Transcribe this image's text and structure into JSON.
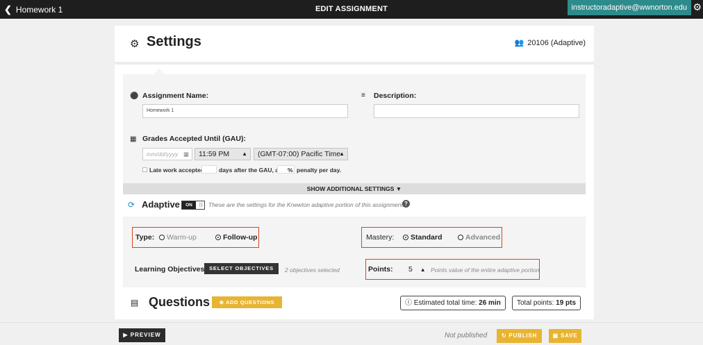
{
  "topbar": {
    "back_label": "Homework 1",
    "title": "EDIT ASSIGNMENT",
    "user_email": "instructoradaptive@wwnorton.edu"
  },
  "settings": {
    "title": "Settings",
    "course_label": "20106 (Adaptive)"
  },
  "assignment": {
    "name_label": "Assignment Name:",
    "name_value": "Homework 1",
    "description_label": "Description:",
    "description_value": "",
    "gau_label": "Grades Accepted Until (GAU):",
    "date_placeholder": "mm/dd/yyyy",
    "time_value": "11:59 PM",
    "timezone_value": "(GMT-07:00) Pacific Time",
    "late_work_label": "Late work accepted",
    "late_days_suffix": "days after the GAU, at",
    "percent_symbol": "%",
    "penalty_suffix": "penalty per day.",
    "show_additional": "SHOW ADDITIONAL SETTINGS"
  },
  "adaptive": {
    "title": "Adaptive",
    "toggle_on": "ON",
    "description": "These are the settings for the Knewton adaptive portion of this assignment.",
    "type_label": "Type:",
    "type_options": [
      "Warm-up",
      "Follow-up"
    ],
    "type_selected": "Follow-up",
    "mastery_label": "Mastery:",
    "mastery_options": [
      "Standard",
      "Advanced"
    ],
    "mastery_selected": "Standard",
    "objectives_label": "Learning Objectives:",
    "select_objectives_button": "SELECT OBJECTIVES",
    "objectives_selected_note": "2 objectives selected",
    "points_label": "Points:",
    "points_value": "5",
    "points_note": "Points value of the entire adaptive portion"
  },
  "questions": {
    "title": "Questions",
    "add_button": "ADD QUESTIONS",
    "estimated_time_label": "Estimated total time:",
    "estimated_time_value": "26 min",
    "total_points_label": "Total points:",
    "total_points_value": "19 pts"
  },
  "footer": {
    "preview_button": "PREVIEW",
    "status": "Not published",
    "publish_button": "PUBLISH",
    "save_button": "SAVE"
  },
  "colors": {
    "topbar_bg": "#1e1e1e",
    "user_badge": "#2e8b8b",
    "accent_yellow": "#e8b431",
    "highlight_red": "#d9431e"
  }
}
